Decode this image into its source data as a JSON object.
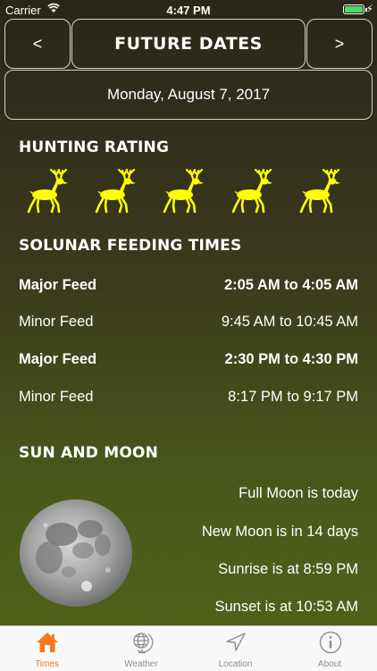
{
  "status_bar": {
    "carrier": "Carrier",
    "time": "4:47 PM",
    "battery_color": "#4cd964",
    "wifi_icon": "wifi-icon",
    "charging_icon": "bolt-icon"
  },
  "header": {
    "prev_label": "<",
    "title": "FUTURE DATES",
    "next_label": ">"
  },
  "date": "Monday, August 7, 2017",
  "hunting": {
    "title": "HUNTING RATING",
    "rating": 5,
    "max_rating": 5,
    "icon": "deer-icon",
    "icon_color": "#ffff00"
  },
  "solunar": {
    "title": "SOLUNAR FEEDING TIMES",
    "items": [
      {
        "label": "Major Feed",
        "value": "2:05 AM to 4:05 AM",
        "bold": true
      },
      {
        "label": "Minor Feed",
        "value": "9:45 AM to 10:45 AM",
        "bold": false
      },
      {
        "label": "Major Feed",
        "value": "2:30 PM to 4:30 PM",
        "bold": true
      },
      {
        "label": "Minor Feed",
        "value": "8:17 PM to 9:17 PM",
        "bold": false
      }
    ]
  },
  "sun_moon": {
    "title": "SUN AND MOON",
    "moon_icon": "full-moon-image",
    "lines": [
      "Full Moon is today",
      "New Moon is in 14 days",
      "Sunrise is at 8:59 PM",
      "Sunset is at 10:53 AM"
    ]
  },
  "tabs": [
    {
      "label": "Times",
      "icon": "home-icon",
      "active": true
    },
    {
      "label": "Weather",
      "icon": "globe-icon",
      "active": false
    },
    {
      "label": "Location",
      "icon": "location-arrow-icon",
      "active": false
    },
    {
      "label": "About",
      "icon": "info-icon",
      "active": false
    }
  ],
  "colors": {
    "active_tab": "#f47a20",
    "inactive_tab": "#8e8e93"
  }
}
